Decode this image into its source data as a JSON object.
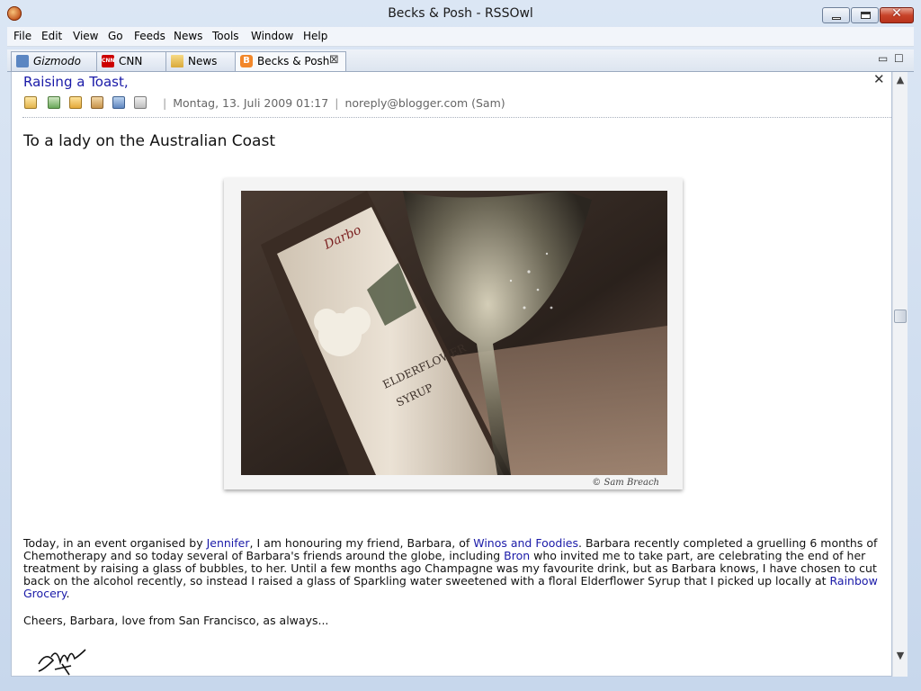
{
  "window": {
    "title": "Becks & Posh - RSSOwl"
  },
  "menu": [
    "File",
    "Edit",
    "View",
    "Go",
    "Feeds",
    "News",
    "Tools",
    "Window",
    "Help"
  ],
  "tabs": [
    {
      "label": "Gizmodo",
      "icon": "rss-feed-icon",
      "active": false
    },
    {
      "label": "CNN",
      "icon": "cnn-logo-icon",
      "active": false
    },
    {
      "label": "News",
      "icon": "folder-icon",
      "active": false
    },
    {
      "label": "Becks & Posh",
      "icon": "blogger-icon",
      "active": true
    }
  ],
  "article": {
    "title": "Raising a Toast,",
    "date": "Montag, 13. Juli 2009 01:17",
    "author": "noreply@blogger.com (Sam)",
    "headline": "To a lady on the Australian Coast",
    "photo_credit": "© Sam Breach",
    "body": {
      "p1_a": "Today, in an event organised by ",
      "link_jennifer": "Jennifer",
      "p1_b": ", I am honouring my friend, Barbara, of ",
      "link_winos": "Winos and Foodies",
      "p1_c": ". Barbara recently completed a gruelling 6 months of Chemotherapy and so today several of Barbara's friends around the globe, including ",
      "link_bron": "Bron",
      "p1_d": " who invited me to take part, are celebrating the end of her treatment by raising a glass of bubbles, to her. Until a few months ago Champagne was my favourite drink, but as Barbara knows, I have chosen to cut back on the alcohol recently, so instead I raised a glass of Sparkling water sweetened with a floral Elderflower Syrup that I picked up locally at ",
      "link_rainbow": "Rainbow Grocery",
      "p1_e": ".",
      "signoff": "Cheers, Barbara, love from San Francisco, as always..."
    }
  },
  "colors": {
    "link": "#1a1aa8",
    "window_frame": "#c9d9ee"
  }
}
